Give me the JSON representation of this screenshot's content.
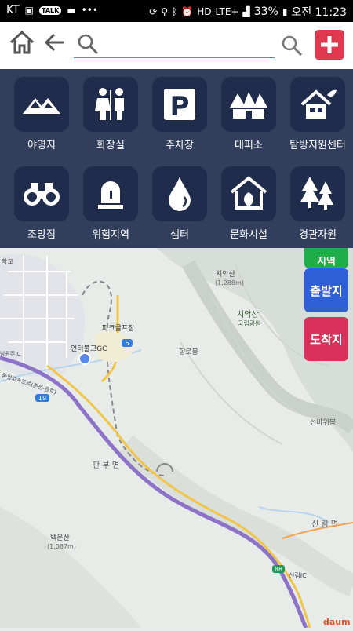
{
  "status_bar": {
    "carrier": "KT",
    "battery": "33%",
    "time": "오전 11:23",
    "network": "LTE+",
    "talk_badge": "TALK"
  },
  "search": {
    "placeholder": "",
    "value": ""
  },
  "categories": [
    {
      "label": "야영지",
      "icon": "mountain-icon"
    },
    {
      "label": "화장실",
      "icon": "restroom-icon"
    },
    {
      "label": "주차장",
      "icon": "parking-icon"
    },
    {
      "label": "대피소",
      "icon": "shelter-icon"
    },
    {
      "label": "탐방지원센터",
      "icon": "visitor-center-icon"
    },
    {
      "label": "조망점",
      "icon": "binoculars-icon"
    },
    {
      "label": "위험지역",
      "icon": "danger-light-icon"
    },
    {
      "label": "샘터",
      "icon": "water-drop-icon"
    },
    {
      "label": "문화시설",
      "icon": "culture-icon"
    },
    {
      "label": "경관자원",
      "icon": "landscape-icon"
    }
  ],
  "side_buttons": {
    "partial_label": "지역",
    "start_label": "출발지",
    "end_label": "도착지"
  },
  "map_labels": {
    "mountain_peak": "치악산",
    "peak_height": "(1,288m)",
    "park_name": "치악산",
    "park_sub": "국립공원",
    "golf_park": "파크골프장",
    "golf_course": "인터불고GC",
    "hyangro_peak": "향로봉",
    "myeon": "판 부 면",
    "seonbawi": "선바위봉",
    "sillim": "신 림 면",
    "baegun": "백운산",
    "baegun_height": "(1,087m)",
    "route_5": "5",
    "route_19": "19",
    "route_88": "88",
    "sillim_ic": "신림IC",
    "school": "학교",
    "namwonju": "남원주IC",
    "highway": "중앙고속도로(춘천-금호)",
    "logo": "daum"
  },
  "colors": {
    "panel_bg": "#263453",
    "tile_bg": "#1f2c4c",
    "plus_red": "#e0384e",
    "start_blue": "#2f5fd6",
    "end_red": "#d8325a",
    "green": "#1fae4a",
    "search_line": "#2aa3d6"
  }
}
